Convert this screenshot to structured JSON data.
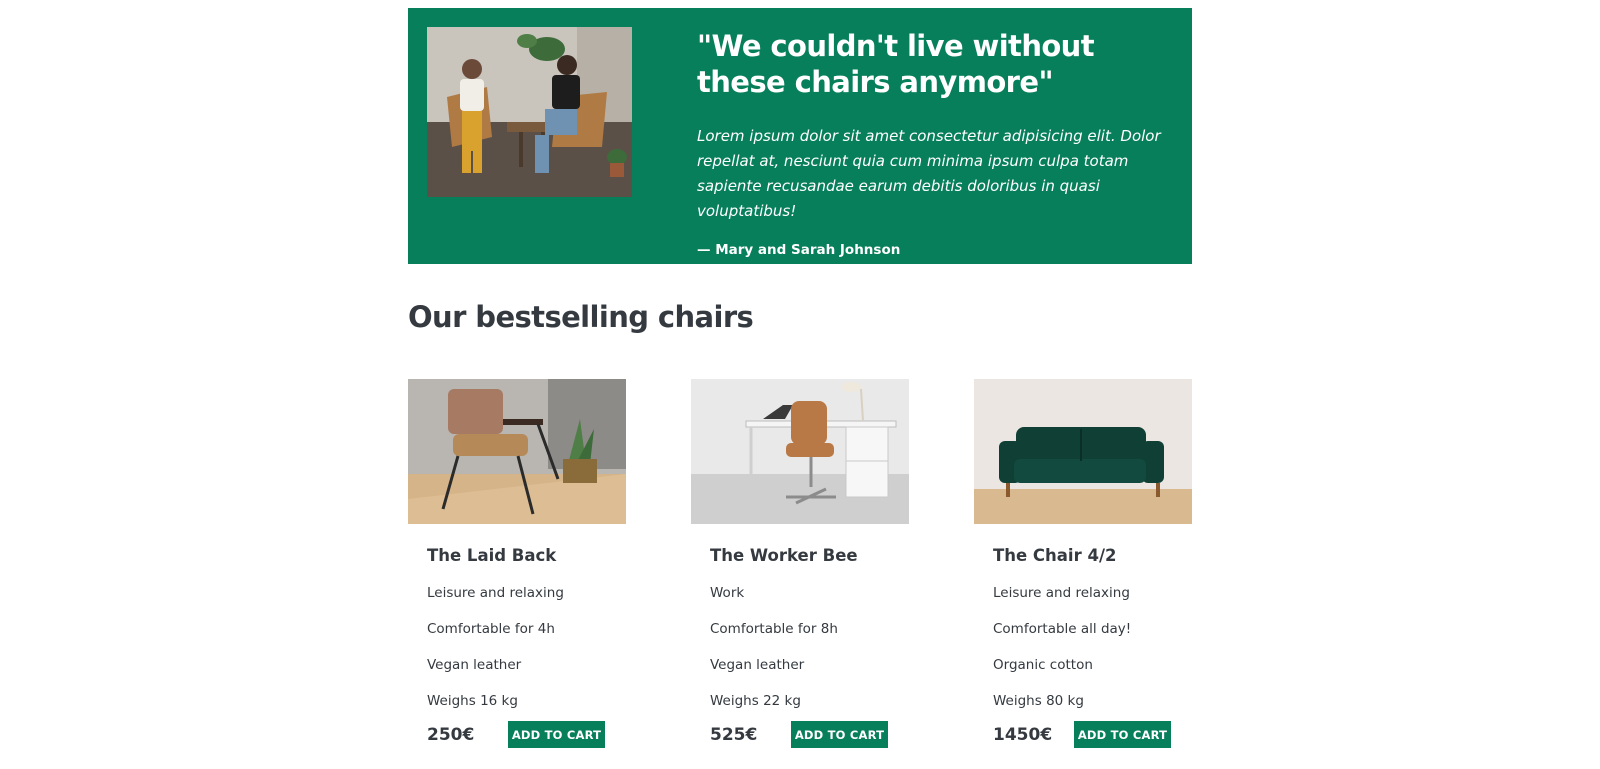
{
  "testimonial": {
    "quote": "\"We couldn't live without these chairs anymore\"",
    "body": "Lorem ipsum dolor sit amet consectetur adipisicing elit. Dolor repellat at, nesciunt quia cum minima ipsum culpa totam sapiente recusandae earum debitis doloribus in quasi voluptatibus!",
    "author": "— Mary and Sarah Johnson"
  },
  "section_title": "Our bestselling chairs",
  "products": [
    {
      "name": "The Laid Back",
      "details": [
        "Leisure and relaxing",
        "Comfortable for 4h",
        "Vegan leather",
        "Weighs 16 kg"
      ],
      "price": "250€",
      "cta": "Add to cart"
    },
    {
      "name": "The Worker Bee",
      "details": [
        "Work",
        "Comfortable for 8h",
        "Vegan leather",
        "Weighs 22 kg"
      ],
      "price": "525€",
      "cta": "Add to cart"
    },
    {
      "name": "The Chair 4/2",
      "details": [
        "Leisure and relaxing",
        "Comfortable all day!",
        "Organic cotton",
        "Weighs 80 kg"
      ],
      "price": "1450€",
      "cta": "Add to cart"
    }
  ],
  "colors": {
    "brand": "#087f5b",
    "text": "#343a40"
  }
}
